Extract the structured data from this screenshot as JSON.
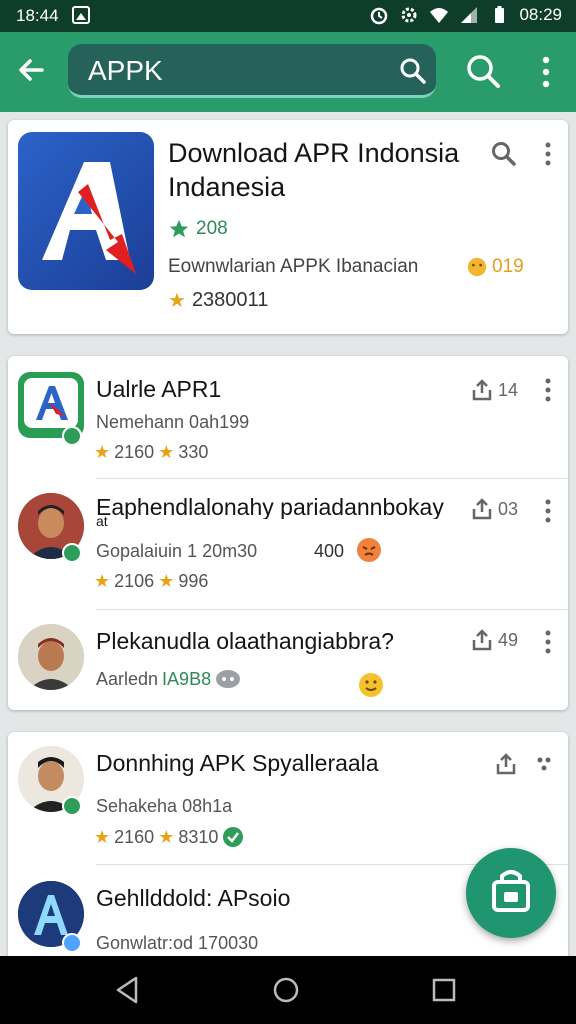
{
  "status_bar": {
    "time_left": "18:44",
    "time_right": "08:29"
  },
  "toolbar": {
    "search_value": "APPK",
    "search_placeholder": ""
  },
  "featured": {
    "title": "Download APR Indonsia Indanesia",
    "rating": "208",
    "subtitle": "Eownwlarian APPK Ibanacian",
    "badge": "019",
    "downloads": "2380011"
  },
  "list1": [
    {
      "title": "Ualrle APR1",
      "subtitle": "Nemehann 0ah199",
      "stat1": "2160",
      "stat2": "330",
      "share": "14"
    },
    {
      "title": "Eaphendlalonahy pariadannbokay",
      "title2": "at",
      "subtitle": "Gopalaiuin 1 20m30",
      "extra": "400",
      "stat1": "2106",
      "stat2": "996",
      "share": "03"
    },
    {
      "title": "Plekanudla olaathangiabbra?",
      "subtitle": "Aarledn",
      "subtitle_green": "IA9B8",
      "share": "49"
    }
  ],
  "list2": [
    {
      "title": "Donnhing APK Spyalleraala",
      "subtitle": "Sehakeha 08h1a",
      "stat1": "2160",
      "stat2": "8310"
    },
    {
      "title": "Gehllddold: APsoio",
      "subtitle": "Gonwlatr:od 170030"
    }
  ],
  "colors": {
    "toolbar": "#2a9c6c",
    "status_bar": "#0f3d2b",
    "fab": "#1f9670",
    "accent_green": "#2e8b57"
  }
}
